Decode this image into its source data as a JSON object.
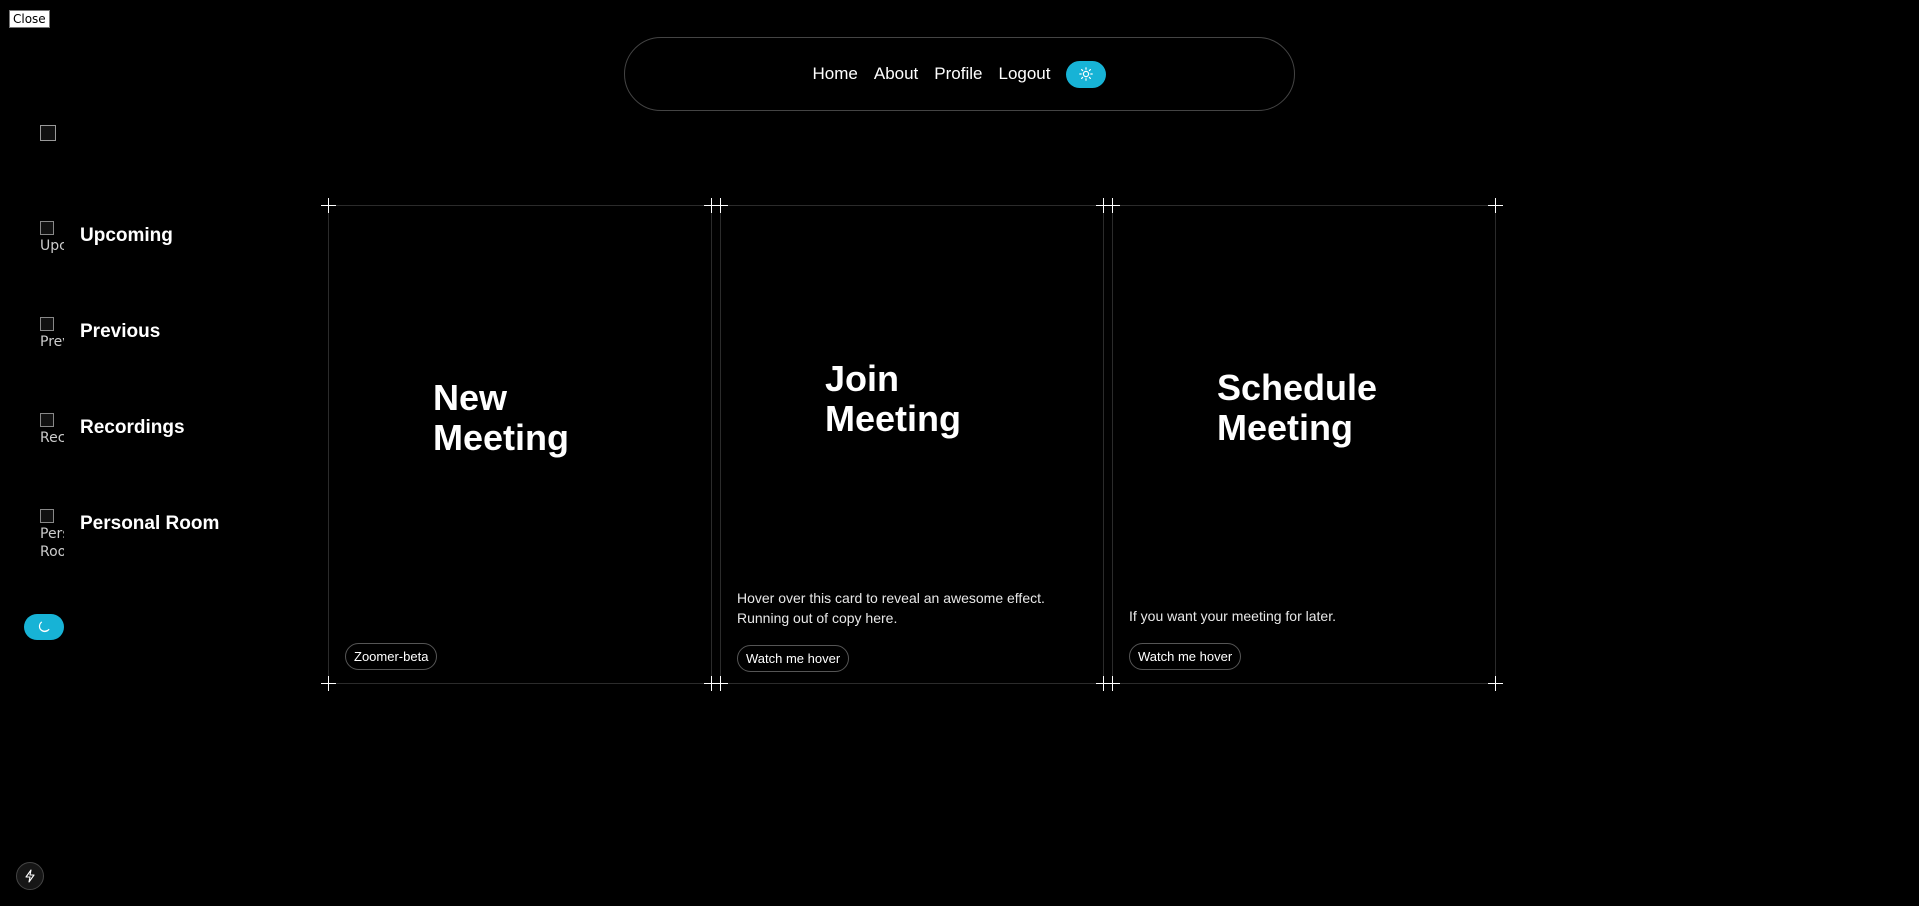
{
  "close_button": "Close",
  "nav": {
    "links": [
      "Home",
      "About",
      "Profile",
      "Logout"
    ],
    "theme_icon": "sun-icon"
  },
  "sidebar": {
    "logo_icon": "logo-image",
    "items": [
      {
        "label": "Upcoming",
        "alt": "Upcoming"
      },
      {
        "label": "Previous",
        "alt": "Previous"
      },
      {
        "label": "Recordings",
        "alt": "Recordings"
      },
      {
        "label": "Personal Room",
        "alt": "Personal Room"
      }
    ],
    "theme_icon": "moon-icon"
  },
  "cards": [
    {
      "title": "New Meeting",
      "description": "",
      "badge": "Zoomer-beta"
    },
    {
      "title": "Join Meeting",
      "description": "Hover over this card to reveal an awesome effect. Running out of copy here.",
      "badge": "Watch me hover"
    },
    {
      "title": "Schedule Meeting",
      "description": "If you want your meeting for later.",
      "badge": "Watch me hover"
    }
  ],
  "colors": {
    "accent": "#17b3d6",
    "background": "#000000",
    "text": "#ffffff"
  },
  "dev_tool_icon": "bolt-icon"
}
